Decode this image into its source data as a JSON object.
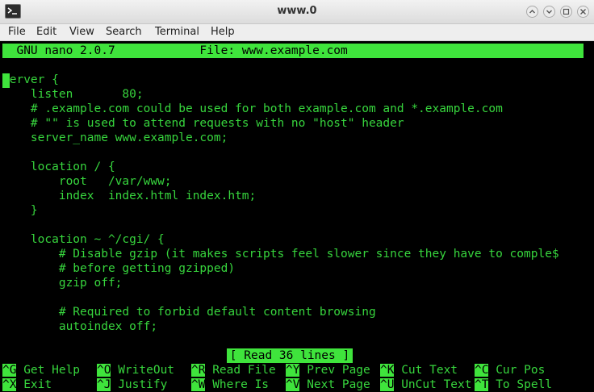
{
  "window": {
    "title": "www.0"
  },
  "menu": [
    "File",
    "Edit",
    "View",
    "Search",
    "Terminal",
    "Help"
  ],
  "nano": {
    "header": "  GNU nano 2.0.7            File: www.example.com",
    "lines": [
      "server {",
      "    listen       80;",
      "    # .example.com could be used for both example.com and *.example.com",
      "    # \"\" is used to attend requests with no \"host\" header",
      "    server_name www.example.com;",
      "",
      "    location / {",
      "        root   /var/www;",
      "        index  index.html index.htm;",
      "    }",
      "",
      "    location ~ ^/cgi/ {",
      "        # Disable gzip (it makes scripts feel slower since they have to comple$",
      "        # before getting gzipped)",
      "        gzip off;",
      "",
      "        # Required to forbid default content browsing",
      "        autoindex off;"
    ],
    "status": "[ Read 36 lines ]",
    "shortcuts_row1": [
      {
        "key": "^G",
        "label": "Get Help"
      },
      {
        "key": "^O",
        "label": "WriteOut"
      },
      {
        "key": "^R",
        "label": "Read File"
      },
      {
        "key": "^Y",
        "label": "Prev Page"
      },
      {
        "key": "^K",
        "label": "Cut Text"
      },
      {
        "key": "^C",
        "label": "Cur Pos"
      }
    ],
    "shortcuts_row2": [
      {
        "key": "^X",
        "label": "Exit"
      },
      {
        "key": "^J",
        "label": "Justify"
      },
      {
        "key": "^W",
        "label": "Where Is"
      },
      {
        "key": "^V",
        "label": "Next Page"
      },
      {
        "key": "^U",
        "label": "UnCut Text"
      },
      {
        "key": "^T",
        "label": "To Spell"
      }
    ]
  },
  "colors": {
    "terminal_fg": "#37d53d",
    "highlight_bg": "#3fe43c",
    "terminal_bg": "#000000"
  }
}
